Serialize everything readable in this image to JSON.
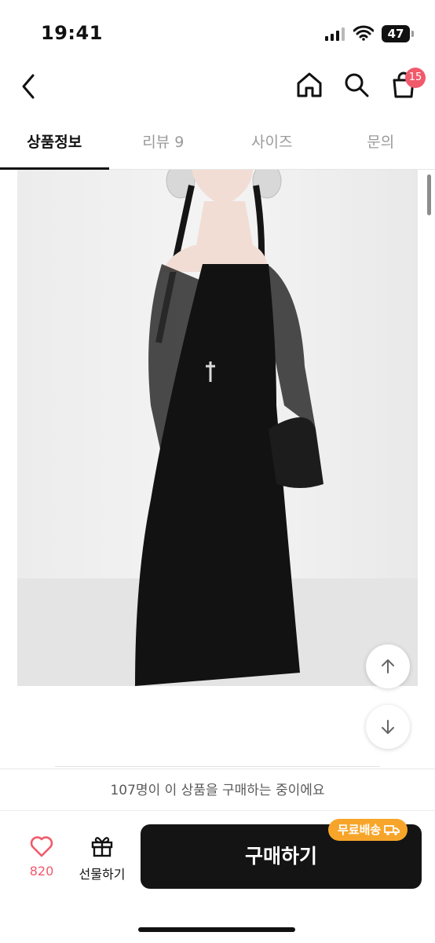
{
  "status_bar": {
    "time": "19:41",
    "battery": "47"
  },
  "nav": {
    "cart_badge": "15"
  },
  "tabs": [
    {
      "label": "상품정보",
      "active": true
    },
    {
      "label": "리뷰 9",
      "active": false
    },
    {
      "label": "사이즈",
      "active": false
    },
    {
      "label": "문의",
      "active": false
    }
  ],
  "purchase_notice": "107명이 이 상품을 구매하는 중이에요",
  "bottom_bar": {
    "like_count": "820",
    "gift_label": "선물하기",
    "buy_label": "구매하기",
    "shipping_badge": "무료배송"
  },
  "colors": {
    "accent_pink": "#f05a6b",
    "badge_orange": "#f7a52a",
    "buy_button": "#141414"
  },
  "icons": [
    "back-arrow-icon",
    "home-icon",
    "search-icon",
    "cart-icon",
    "arrow-up-icon",
    "arrow-down-icon",
    "heart-icon",
    "gift-icon",
    "truck-icon"
  ]
}
